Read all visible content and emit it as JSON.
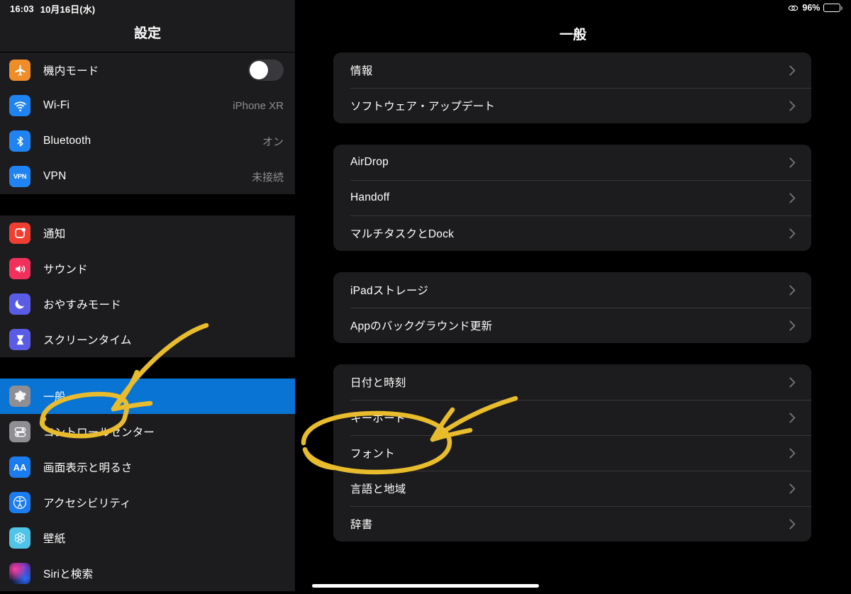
{
  "status_bar": {
    "time": "16:03",
    "date": "10月16日(水)",
    "link_icon": "link-chain-icon",
    "battery_percent": "96%",
    "battery_level": 96
  },
  "sidebar": {
    "title": "設定",
    "groups": [
      {
        "items": [
          {
            "label": "機内モード",
            "icon": "airplane-icon",
            "control": "toggle",
            "toggle_on": false
          },
          {
            "label": "Wi-Fi",
            "icon": "wifi-icon",
            "value": "iPhone XR"
          },
          {
            "label": "Bluetooth",
            "icon": "bluetooth-icon",
            "value": "オン"
          },
          {
            "label": "VPN",
            "icon": "vpn-icon",
            "value": "未接続"
          }
        ]
      },
      {
        "items": [
          {
            "label": "通知",
            "icon": "notifications-icon"
          },
          {
            "label": "サウンド",
            "icon": "sound-icon"
          },
          {
            "label": "おやすみモード",
            "icon": "moon-icon"
          },
          {
            "label": "スクリーンタイム",
            "icon": "hourglass-icon"
          }
        ]
      },
      {
        "items": [
          {
            "label": "一般",
            "icon": "gear-icon",
            "selected": true
          },
          {
            "label": "コントロールセンター",
            "icon": "control-center-icon"
          },
          {
            "label": "画面表示と明るさ",
            "icon": "display-aa-icon"
          },
          {
            "label": "アクセシビリティ",
            "icon": "accessibility-icon"
          },
          {
            "label": "壁紙",
            "icon": "wallpaper-icon"
          },
          {
            "label": "Siriと検索",
            "icon": "siri-icon"
          }
        ]
      }
    ]
  },
  "detail": {
    "title": "一般",
    "groups": [
      {
        "items": [
          {
            "label": "情報"
          },
          {
            "label": "ソフトウェア・アップデート"
          }
        ]
      },
      {
        "items": [
          {
            "label": "AirDrop"
          },
          {
            "label": "Handoff"
          },
          {
            "label": "マルチタスクとDock"
          }
        ]
      },
      {
        "items": [
          {
            "label": "iPadストレージ"
          },
          {
            "label": "Appのバックグラウンド更新"
          }
        ]
      },
      {
        "items": [
          {
            "label": "日付と時刻"
          },
          {
            "label": "キーボード",
            "annotated": true
          },
          {
            "label": "フォント"
          },
          {
            "label": "言語と地域"
          },
          {
            "label": "辞書"
          }
        ]
      }
    ]
  },
  "annotations": {
    "color": "#e8bc2c",
    "marks": [
      {
        "name": "circle-general",
        "target": "一般"
      },
      {
        "name": "arrow-to-general",
        "target": "一般"
      },
      {
        "name": "circle-keyboard",
        "target": "キーボード"
      },
      {
        "name": "arrow-to-keyboard",
        "target": "キーボード"
      }
    ]
  },
  "colors": {
    "accent_selected": "#0a74d4",
    "card_background": "#1c1c1e",
    "page_background": "#000000",
    "secondary_text": "#8e8e93",
    "annotation": "#e8bc2c"
  }
}
